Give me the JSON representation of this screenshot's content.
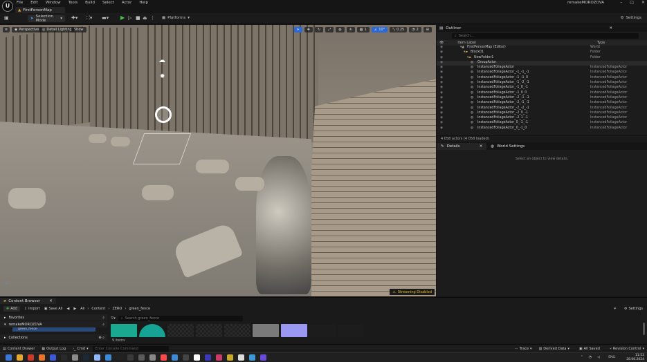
{
  "menu": {
    "items": [
      "File",
      "Edit",
      "Window",
      "Tools",
      "Build",
      "Select",
      "Actor",
      "Help"
    ],
    "project": "remakeMOROZOVA"
  },
  "map_tab": "FirstPersonMap",
  "toolbar": {
    "selection_mode": "Selection Mode",
    "platforms": "Platforms",
    "settings": "Settings"
  },
  "viewport": {
    "perspective": "Perspective",
    "lighting": "Detail Lighting",
    "show": "Show",
    "grid_value": "1",
    "angle_value": "10°",
    "scale_value": "0.25",
    "camera_speed": "2",
    "streaming": "Streaming Disabled"
  },
  "outliner": {
    "title": "Outliner",
    "search_placeholder": "Search...",
    "col_label": "Item Label",
    "col_type": "Type",
    "rows": [
      {
        "label": "FirstPersonMap (Editor)",
        "type": "World",
        "indent": 0
      },
      {
        "label": "Block01",
        "type": "Folder",
        "indent": 1
      },
      {
        "label": "NewFolder1",
        "type": "Folder",
        "indent": 2
      },
      {
        "label": "GroupActor",
        "type": "",
        "indent": 3
      },
      {
        "label": "InstancedFoliageActor",
        "type": "InstancedFoliageActor",
        "indent": 3
      },
      {
        "label": "InstancedFoliageActor_-1_-1_-1",
        "type": "InstancedFoliageActor",
        "indent": 3
      },
      {
        "label": "InstancedFoliageActor_-1_-1_0",
        "type": "InstancedFoliageActor",
        "indent": 3
      },
      {
        "label": "InstancedFoliageActor_-1_-2_-1",
        "type": "InstancedFoliageActor",
        "indent": 3
      },
      {
        "label": "InstancedFoliageActor_-1_0_-1",
        "type": "InstancedFoliageActor",
        "indent": 3
      },
      {
        "label": "InstancedFoliageActor_-1_0_0",
        "type": "InstancedFoliageActor",
        "indent": 3
      },
      {
        "label": "InstancedFoliageActor_-2_-1_-1",
        "type": "InstancedFoliageActor",
        "indent": 3
      },
      {
        "label": "InstancedFoliageActor_-2_-1_-1",
        "type": "InstancedFoliageActor",
        "indent": 3
      },
      {
        "label": "InstancedFoliageActor_-2_-2_-1",
        "type": "InstancedFoliageActor",
        "indent": 3
      },
      {
        "label": "InstancedFoliageActor_-2_0_-1",
        "type": "InstancedFoliageActor",
        "indent": 3
      },
      {
        "label": "InstancedFoliageActor_-2_1_-1",
        "type": "InstancedFoliageActor",
        "indent": 3
      },
      {
        "label": "InstancedFoliageActor_0_-1_-1",
        "type": "InstancedFoliageActor",
        "indent": 3
      },
      {
        "label": "InstancedFoliageActor_0_-1_0",
        "type": "InstancedFoliageActor",
        "indent": 3
      }
    ],
    "footer": "4 058 actors (4 058 loaded)"
  },
  "details": {
    "tab_details": "Details",
    "tab_world": "World Settings",
    "empty_msg": "Select an object to view details."
  },
  "content_browser": {
    "tab": "Content Browser",
    "add": "Add",
    "import": "Import",
    "save_all": "Save All",
    "path": [
      "All",
      "Content",
      "ZERO",
      "green_fence"
    ],
    "settings": "Settings",
    "favorites": "Favorites",
    "project": "remakeMOROZOVA",
    "folder": "green_fence",
    "collections": "Collections",
    "search_placeholder": "Search green_fence",
    "item_count": "9 items",
    "thumb_colors": [
      "#1aa890",
      "#16a393",
      "#222",
      "#222",
      "#222",
      "#7a7a7a",
      "#9a98f0",
      "#1c1c1c",
      "#1c1c1c"
    ]
  },
  "status": {
    "drawer": "Content Drawer",
    "output": "Output Log",
    "cmd": "Cmd",
    "cmd_placeholder": "Enter Console Command",
    "trace": "Trace",
    "derived": "Derived Data",
    "saved": "All Saved",
    "revision": "Revision Control"
  },
  "taskbar": {
    "lang": "ENG",
    "time": "11:53",
    "date": "28.06.2024",
    "icons": [
      "#3a78d8",
      "#e8a62a",
      "#cc3a2a",
      "#e8762a",
      "#3a5ad8",
      "#2a2a2a",
      "#8a8a8a",
      "#1b2838",
      "#8fb8ff",
      "#3a8ad8",
      "#222",
      "#3a3a3a",
      "#5a5a5a",
      "#888",
      "#ff4a4a",
      "#3a8ad8",
      "#444",
      "#fff",
      "#3a3ab8",
      "#cc3a6a",
      "#c8a82a",
      "#ddd",
      "#3a9ad8",
      "#6a4ad8"
    ]
  }
}
